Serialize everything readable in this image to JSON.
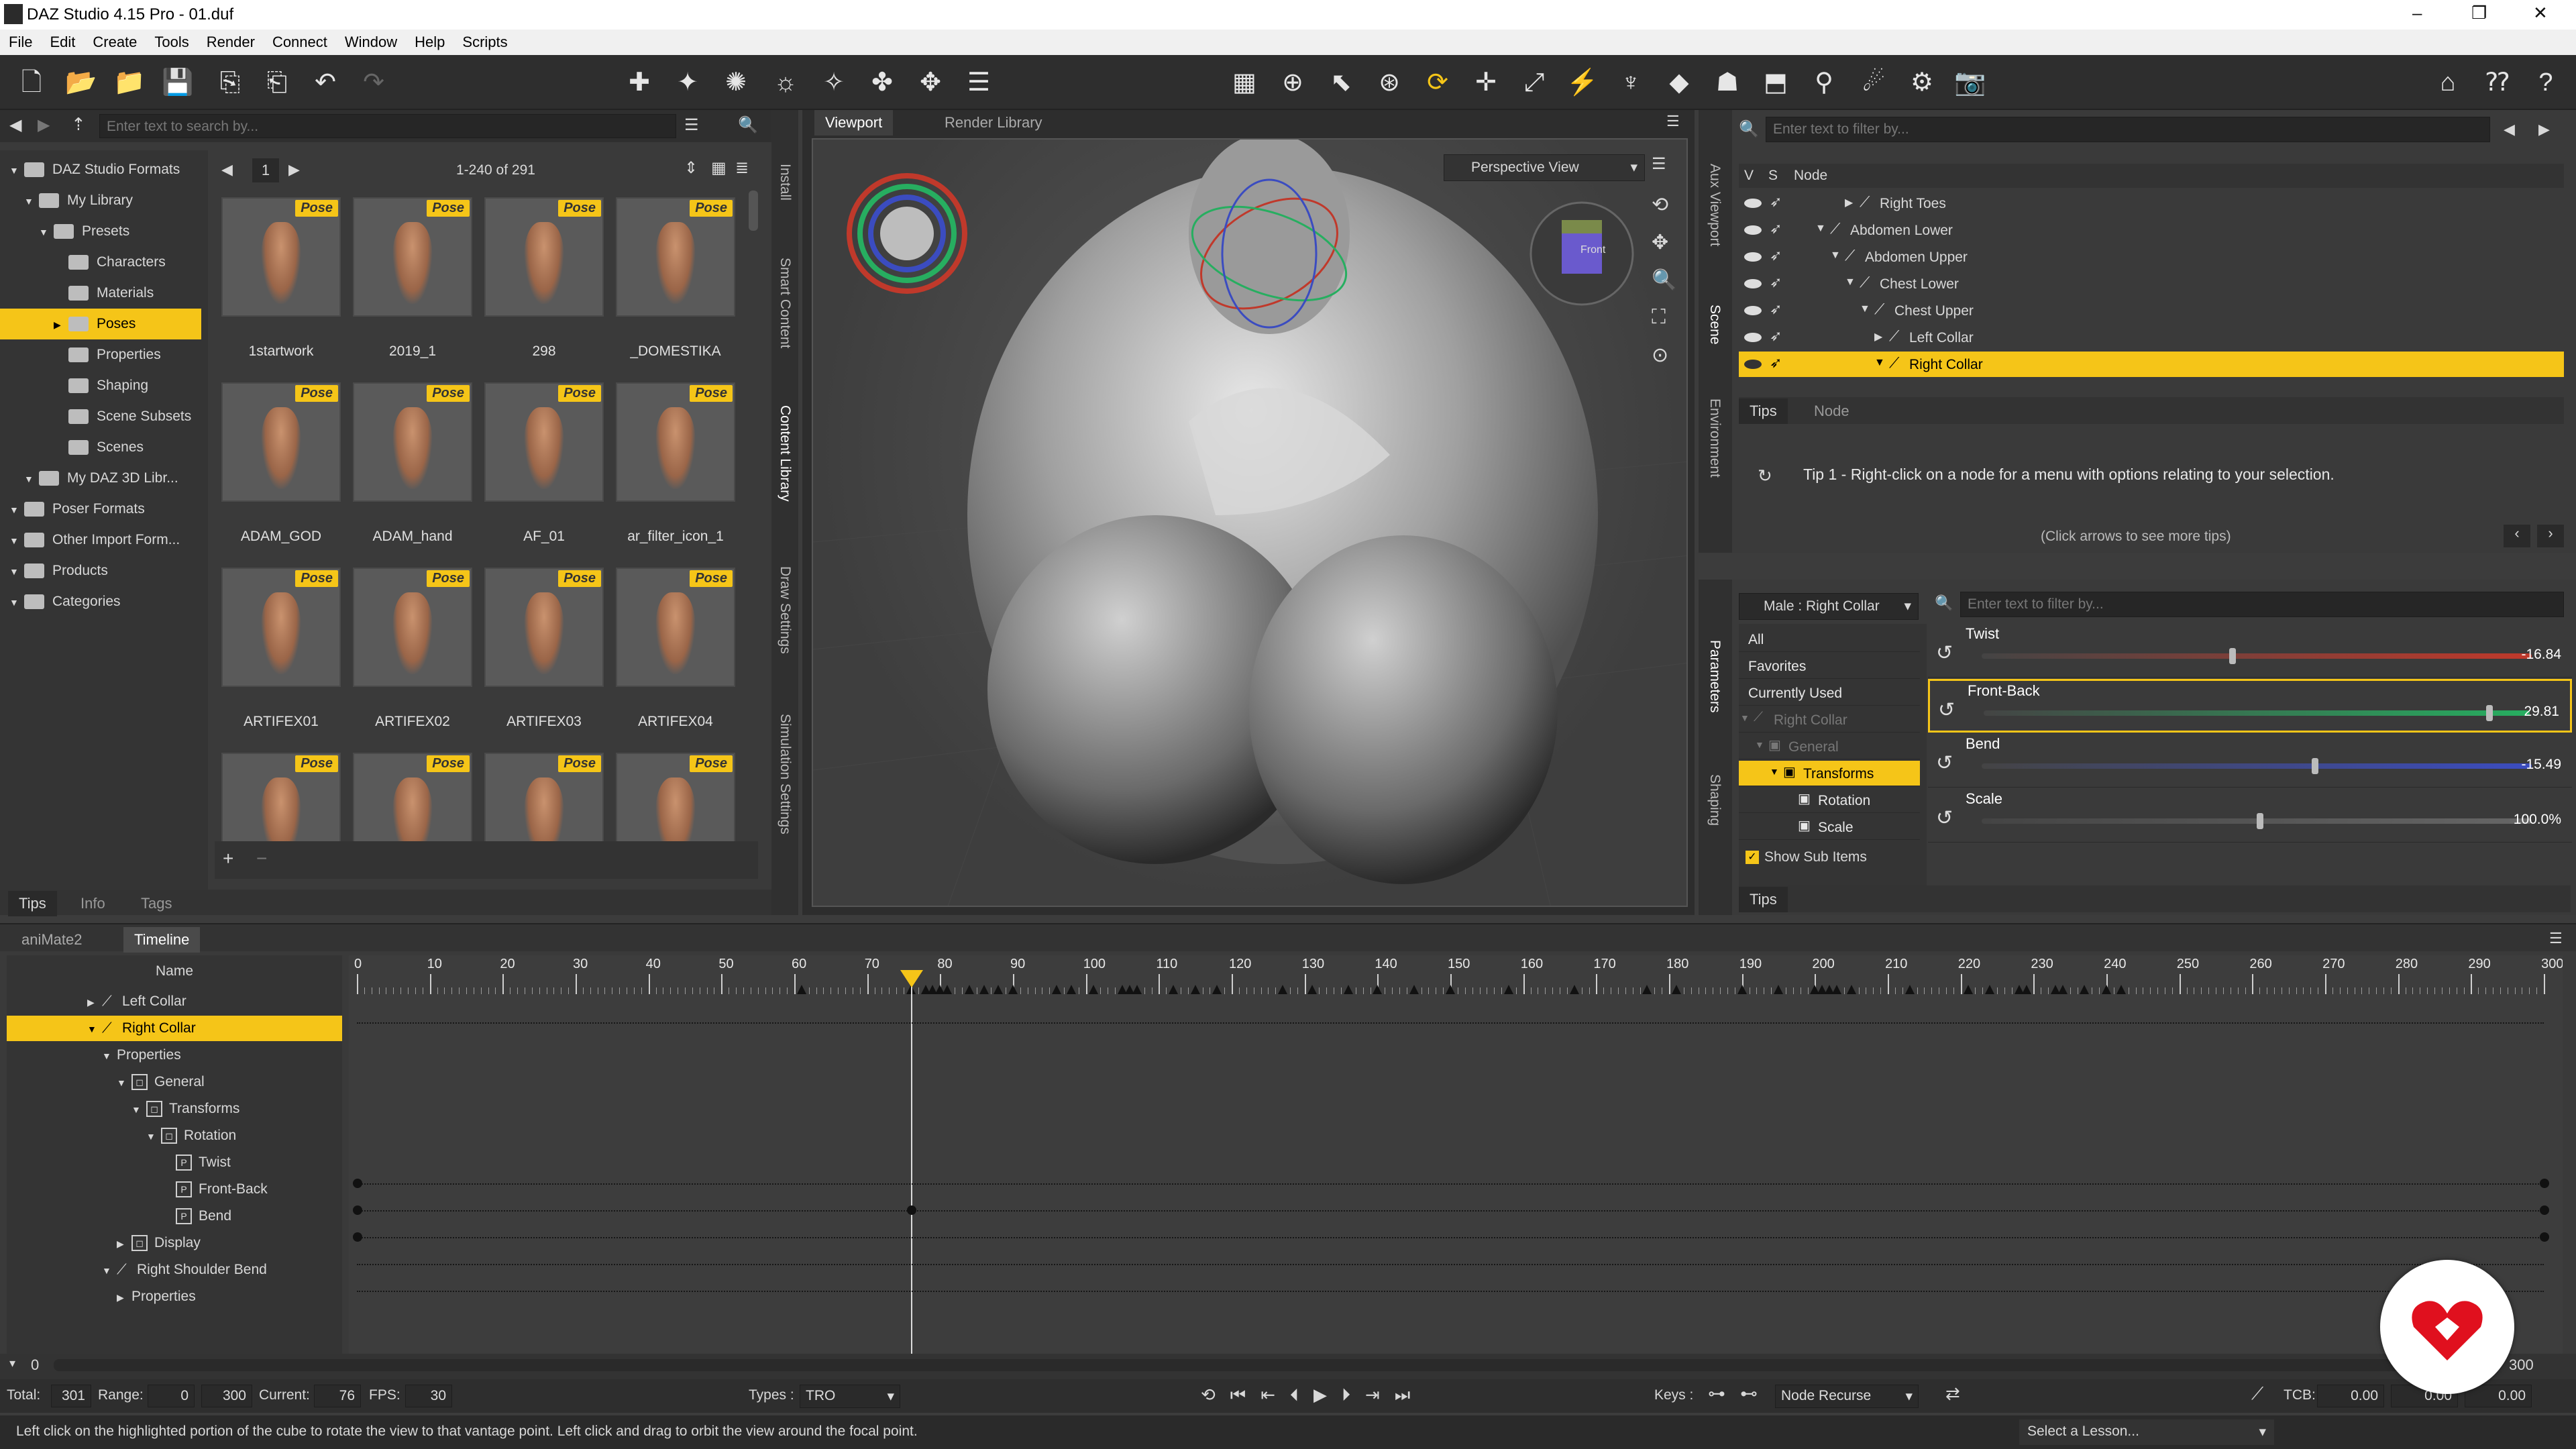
{
  "window": {
    "title": "DAZ Studio 4.15 Pro - 01.duf",
    "min": "–",
    "max": "❐",
    "close": "✕"
  },
  "menu": [
    "File",
    "Edit",
    "Create",
    "Tools",
    "Render",
    "Connect",
    "Window",
    "Help",
    "Scripts"
  ],
  "toolbar_icons": [
    "new-file-icon",
    "open-icon",
    "open-recent-icon",
    "save-icon",
    "import-icon",
    "export-icon",
    "undo-icon",
    "redo-icon"
  ],
  "content": {
    "search_placeholder": "Enter text to search by...",
    "tree": [
      {
        "label": "DAZ Studio Formats",
        "level": 0
      },
      {
        "label": "My Library",
        "level": 1
      },
      {
        "label": "Presets",
        "level": 2
      },
      {
        "label": "Characters",
        "level": 3
      },
      {
        "label": "Materials",
        "level": 3
      },
      {
        "label": "Poses",
        "level": 3,
        "selected": true
      },
      {
        "label": "Properties",
        "level": 3
      },
      {
        "label": "Shaping",
        "level": 3
      },
      {
        "label": "Scene Subsets",
        "level": 3
      },
      {
        "label": "Scenes",
        "level": 3
      },
      {
        "label": "My DAZ 3D Libr...",
        "level": 1
      },
      {
        "label": "Poser Formats",
        "level": 0
      },
      {
        "label": "Other Import Form...",
        "level": 0
      },
      {
        "label": "Products",
        "level": 0
      },
      {
        "label": "Categories",
        "level": 0
      }
    ],
    "page": "1",
    "range": "1-240 of 291",
    "badge": "Pose",
    "items": [
      "1startwork",
      "2019_1",
      "298",
      "_DOMESTIKA",
      "ADAM_GOD",
      "ADAM_hand",
      "AF_01",
      "ar_filter_icon_1",
      "ARTIFEX01",
      "ARTIFEX02",
      "ARTIFEX03",
      "ARTIFEX04",
      "",
      "",
      "",
      ""
    ],
    "bottom_tabs": [
      "Tips",
      "Info",
      "Tags"
    ],
    "side_tabs": [
      "Install",
      "Smart Content",
      "Content Library",
      "Draw Settings",
      "Simulation Settings"
    ]
  },
  "viewport": {
    "tabs": [
      "Viewport",
      "Render Library"
    ],
    "camera": "Perspective View",
    "cube_label": "Front"
  },
  "scene": {
    "filter_placeholder": "Enter text to filter by...",
    "col_v": "V",
    "col_s": "S",
    "col_node": "Node",
    "nodes": [
      {
        "label": "Right Toes",
        "indent": 4,
        "arrow": "▶"
      },
      {
        "label": "Abdomen Lower",
        "indent": 2,
        "arrow": "▼"
      },
      {
        "label": "Abdomen Upper",
        "indent": 3,
        "arrow": "▼"
      },
      {
        "label": "Chest Lower",
        "indent": 4,
        "arrow": "▼"
      },
      {
        "label": "Chest Upper",
        "indent": 5,
        "arrow": "▼"
      },
      {
        "label": "Left Collar",
        "indent": 6,
        "arrow": "▶"
      },
      {
        "label": "Right Collar",
        "indent": 6,
        "arrow": "▼",
        "selected": true
      }
    ],
    "side_tabs": [
      "Aux Viewport",
      "Scene",
      "Environment"
    ],
    "tips_tabs": [
      "Tips",
      "Node"
    ],
    "tip_text": "Tip 1 - Right-click on a node for a menu with options relating to your selection.",
    "tip_hint": "(Click arrows to see more tips)"
  },
  "params": {
    "node_select": "Male : Right Collar",
    "filter_placeholder": "Enter text to filter by...",
    "groups": [
      {
        "label": "All"
      },
      {
        "label": "Favorites"
      },
      {
        "label": "Currently Used"
      },
      {
        "label": "Right Collar",
        "dim": true
      },
      {
        "label": "General",
        "dim": true
      },
      {
        "label": "Transforms",
        "selected": true
      },
      {
        "label": "Rotation"
      },
      {
        "label": "Scale"
      }
    ],
    "show_sub": "Show Sub Items",
    "sliders": [
      {
        "name": "Twist",
        "value": "-16.84",
        "fraction": 0.45,
        "color": "#c0392b"
      },
      {
        "name": "Front-Back",
        "value": "29.81",
        "fraction": 0.92,
        "color": "#27ae60"
      },
      {
        "name": "Bend",
        "value": "-15.49",
        "fraction": 0.6,
        "color": "#3b4cc0"
      },
      {
        "name": "Scale",
        "value": "100.0%",
        "fraction": 0.5,
        "color": "#666666"
      }
    ],
    "side_tabs": [
      "Parameters",
      "Shaping"
    ],
    "bottom_tab": "Tips"
  },
  "timeline": {
    "tabs": [
      "aniMate2",
      "Timeline"
    ],
    "name_header": "Name",
    "rows": [
      {
        "label": "Left Collar",
        "indent": 0,
        "arrow": "▶",
        "type": "bone"
      },
      {
        "label": "Right Collar",
        "indent": 0,
        "arrow": "▼",
        "type": "bone",
        "selected": true
      },
      {
        "label": "Properties",
        "indent": 1,
        "arrow": "▼",
        "type": "none"
      },
      {
        "label": "General",
        "indent": 2,
        "arrow": "▼",
        "type": "group"
      },
      {
        "label": "Transforms",
        "indent": 3,
        "arrow": "▼",
        "type": "group"
      },
      {
        "label": "Rotation",
        "indent": 4,
        "arrow": "▼",
        "type": "group"
      },
      {
        "label": "Twist",
        "indent": 5,
        "arrow": "",
        "type": "prop"
      },
      {
        "label": "Front-Back",
        "indent": 5,
        "arrow": "",
        "type": "prop"
      },
      {
        "label": "Bend",
        "indent": 5,
        "arrow": "",
        "type": "prop"
      },
      {
        "label": "Display",
        "indent": 2,
        "arrow": "▶",
        "type": "group"
      },
      {
        "label": "Right Shoulder Bend",
        "indent": 1,
        "arrow": "▼",
        "type": "bone"
      },
      {
        "label": "Properties",
        "indent": 2,
        "arrow": "▶",
        "type": "none"
      }
    ],
    "ruler": [
      "0",
      "10",
      "20",
      "30",
      "40",
      "50",
      "60",
      "70",
      "80",
      "90",
      "100",
      "110",
      "120",
      "130",
      "140",
      "150",
      "160",
      "170",
      "180",
      "190",
      "200",
      "210",
      "220",
      "230",
      "240",
      "250",
      "260",
      "270",
      "280",
      "290",
      "300"
    ],
    "current_frame": 76,
    "keyframes": [
      61,
      76,
      78,
      79,
      80,
      81,
      84,
      86,
      88,
      90,
      96,
      98,
      101,
      105,
      106,
      107,
      112,
      115,
      118,
      127,
      131,
      136,
      140,
      145,
      150,
      158,
      167,
      177,
      181,
      190,
      195,
      200,
      201,
      202,
      203,
      205,
      213,
      221,
      224,
      228,
      229,
      233,
      234,
      237,
      240,
      242
    ],
    "scroll_start": "0",
    "scroll_end": "300",
    "footer": {
      "total_label": "Total:",
      "total": "301",
      "range_label": "Range:",
      "range_start": "0",
      "range_end": "300",
      "current_label": "Current:",
      "current": "76",
      "fps_label": "FPS:",
      "fps": "30",
      "types_label": "Types :",
      "types": "TRO",
      "keys_label": "Keys :",
      "keys_mode": "Node Recurse",
      "tcb_label": "TCB:",
      "tcb1": "0.00",
      "tcb2": "0.00",
      "tcb3": "0.00"
    }
  },
  "status": {
    "text": "Left click on the highlighted portion of the cube to rotate the view to that vantage point. Left click and drag to orbit the view around the focal point.",
    "lesson": "Select a Lesson..."
  }
}
